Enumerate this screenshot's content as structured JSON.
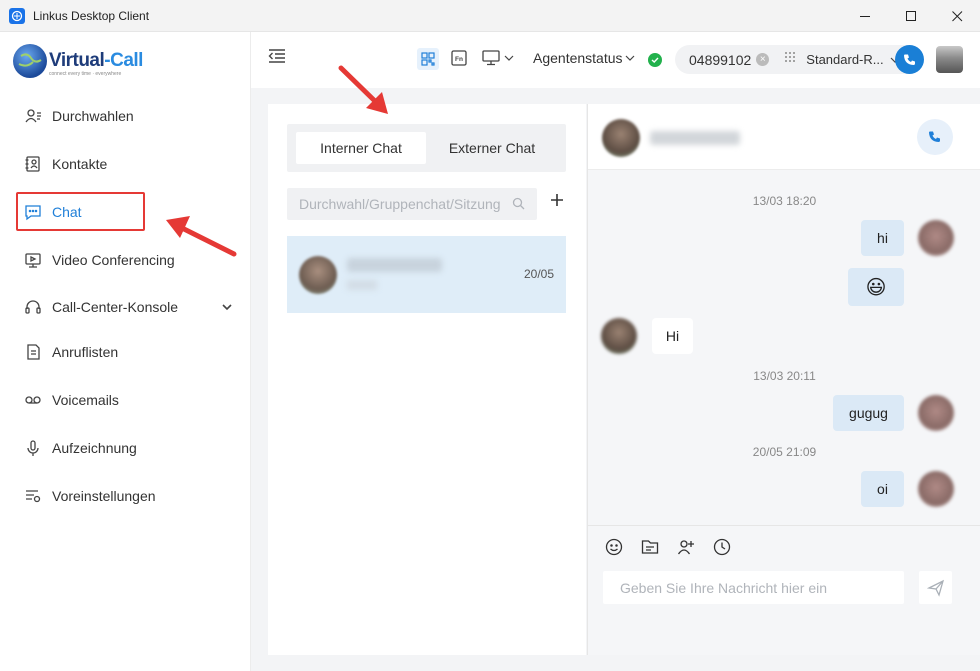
{
  "window": {
    "title": "Linkus Desktop Client"
  },
  "logo": {
    "brand_main": "Virtual",
    "brand_accent": "-Call",
    "tagline": "connect every time · everywhere"
  },
  "sidebar": {
    "items": [
      {
        "label": "Durchwahlen",
        "icon": "contacts-person-icon"
      },
      {
        "label": "Kontakte",
        "icon": "address-book-icon"
      },
      {
        "label": "Chat",
        "icon": "chat-bubble-icon",
        "active": true
      },
      {
        "label": "Video Conferencing",
        "icon": "monitor-video-icon"
      },
      {
        "label": "Call-Center-Konsole",
        "icon": "headset-icon"
      },
      {
        "label": "Anruflisten",
        "icon": "call-log-icon"
      },
      {
        "label": "Voicemails",
        "icon": "voicemail-icon"
      },
      {
        "label": "Aufzeichnung",
        "icon": "microphone-icon"
      },
      {
        "label": "Voreinstellungen",
        "icon": "settings-list-icon"
      }
    ]
  },
  "toolbar": {
    "agent_status_label": "Agentenstatus",
    "dial_number": "04899102",
    "route_label": "Standard-R..."
  },
  "chat_list": {
    "tabs": [
      {
        "label": "Interner Chat",
        "active": true
      },
      {
        "label": "Externer Chat",
        "active": false
      }
    ],
    "search_placeholder": "Durchwahl/Gruppenchat/Sitzung",
    "conversations": [
      {
        "date": "20/05"
      }
    ]
  },
  "conversation": {
    "messages": [
      {
        "type": "time",
        "text": "13/03 18:20"
      },
      {
        "type": "out",
        "text": "hi"
      },
      {
        "type": "out",
        "text": "😃"
      },
      {
        "type": "in",
        "text": "Hi"
      },
      {
        "type": "time",
        "text": "13/03 20:11"
      },
      {
        "type": "out",
        "text": "gugug"
      },
      {
        "type": "time",
        "text": "20/05 21:09"
      },
      {
        "type": "out",
        "text": "oi"
      }
    ],
    "input_placeholder": "Geben Sie Ihre Nachricht hier ein"
  },
  "colors": {
    "accent": "#1f7fd8",
    "status_green": "#22b14c",
    "annotation_red": "#e53935",
    "bubble_out": "#dbe9f6"
  }
}
